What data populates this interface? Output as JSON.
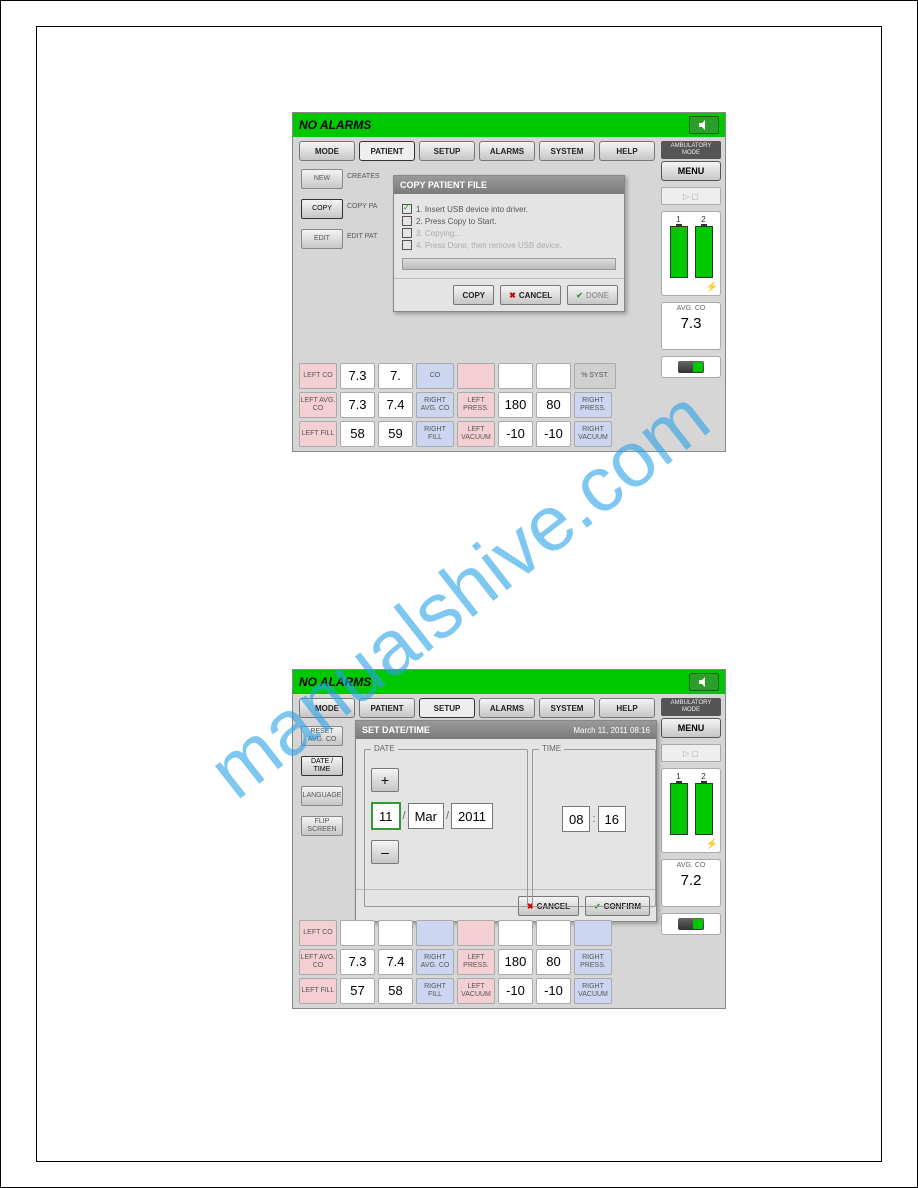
{
  "watermark": "manualshive.com",
  "top": {
    "title": "NO ALARMS",
    "menu": [
      "MODE",
      "PATIENT",
      "SETUP",
      "ALARMS",
      "SYSTEM",
      "HELP"
    ],
    "active_menu": 1,
    "side": {
      "amb": "AMBULATORY MODE",
      "menu": "MENU",
      "bat": [
        "1",
        "2"
      ],
      "avg_l": "AVG. CO",
      "avg_v": "7.3"
    },
    "left_btns": [
      "NEW",
      "COPY",
      "EDIT"
    ],
    "left_lbls": [
      "CREATES",
      "COPY PA",
      "EDIT PAT"
    ],
    "dialog": {
      "title": "COPY PATIENT FILE",
      "steps": [
        {
          "c": true,
          "t": "1. Insert USB device into driver."
        },
        {
          "c": false,
          "t": "2. Press Copy to Start."
        },
        {
          "c": false,
          "t": "3. Copying..."
        },
        {
          "c": false,
          "t": "4. Press Done, then remove USB device."
        }
      ],
      "btns": {
        "copy": "COPY",
        "cancel": "CANCEL",
        "done": "DONE"
      }
    },
    "grid": [
      [
        {
          "t": "pink",
          "v": "LEFT CO"
        },
        {
          "t": "val",
          "v": "7.3"
        },
        {
          "t": "val",
          "v": "7."
        },
        {
          "t": "blue",
          "v": "CO"
        },
        {
          "t": "pink",
          "v": ""
        },
        {
          "t": "val",
          "v": ""
        },
        {
          "t": "val",
          "v": ""
        },
        {
          "t": "sys",
          "v": "% SYST."
        }
      ],
      [
        {
          "t": "pink",
          "v": "LEFT AVG. CO"
        },
        {
          "t": "val",
          "v": "7.3"
        },
        {
          "t": "val",
          "v": "7.4"
        },
        {
          "t": "blue",
          "v": "RIGHT AVG. CO"
        },
        {
          "t": "pink",
          "v": "LEFT PRESS."
        },
        {
          "t": "val",
          "v": "180"
        },
        {
          "t": "val",
          "v": "80"
        },
        {
          "t": "blue",
          "v": "RIGHT PRESS."
        }
      ],
      [
        {
          "t": "pink",
          "v": "LEFT FILL"
        },
        {
          "t": "val",
          "v": "58"
        },
        {
          "t": "val",
          "v": "59"
        },
        {
          "t": "blue",
          "v": "RIGHT FILL"
        },
        {
          "t": "pink",
          "v": "LEFT VACUUM"
        },
        {
          "t": "val",
          "v": "-10"
        },
        {
          "t": "val",
          "v": "-10"
        },
        {
          "t": "blue",
          "v": "RIGHT VACUUM"
        }
      ]
    ]
  },
  "bot": {
    "title": "NO ALARMS",
    "menu": [
      "MODE",
      "PATIENT",
      "SETUP",
      "ALARMS",
      "SYSTEM",
      "HELP"
    ],
    "active_menu": 2,
    "side": {
      "amb": "AMBULATORY MODE",
      "menu": "MENU",
      "bat": [
        "1",
        "2"
      ],
      "avg_l": "AVG. CO",
      "avg_v": "7.2"
    },
    "left_btns": [
      "RESET AVG. CO",
      "DATE / TIME",
      "LANGUAGE",
      "FLIP SCREEN"
    ],
    "dialog": {
      "title": "SET DATE/TIME",
      "stamp": "March 11, 2011  08:16",
      "date_lbl": "DATE",
      "time_lbl": "TIME",
      "day": "11",
      "mon": "Mar",
      "yr": "2011",
      "hr": "08",
      "min": "16",
      "plus": "+",
      "minus": "–",
      "btns": {
        "cancel": "CANCEL",
        "confirm": "CONFIRM"
      }
    },
    "grid": [
      [
        {
          "t": "pink",
          "v": "LEFT CO"
        },
        {
          "t": "val",
          "v": ""
        },
        {
          "t": "val",
          "v": ""
        },
        {
          "t": "blue",
          "v": ""
        },
        {
          "t": "pink",
          "v": ""
        },
        {
          "t": "val",
          "v": ""
        },
        {
          "t": "val",
          "v": ""
        },
        {
          "t": "blue",
          "v": ""
        }
      ],
      [
        {
          "t": "pink",
          "v": "LEFT AVG. CO"
        },
        {
          "t": "val",
          "v": "7.3"
        },
        {
          "t": "val",
          "v": "7.4"
        },
        {
          "t": "blue",
          "v": "RIGHT AVG. CO"
        },
        {
          "t": "pink",
          "v": "LEFT PRESS."
        },
        {
          "t": "val",
          "v": "180"
        },
        {
          "t": "val",
          "v": "80"
        },
        {
          "t": "blue",
          "v": "RIGHT PRESS."
        }
      ],
      [
        {
          "t": "pink",
          "v": "LEFT FILL"
        },
        {
          "t": "val",
          "v": "57"
        },
        {
          "t": "val",
          "v": "58"
        },
        {
          "t": "blue",
          "v": "RIGHT FILL"
        },
        {
          "t": "pink",
          "v": "LEFT VACUUM"
        },
        {
          "t": "val",
          "v": "-10"
        },
        {
          "t": "val",
          "v": "-10"
        },
        {
          "t": "blue",
          "v": "RIGHT VACUUM"
        }
      ]
    ]
  }
}
